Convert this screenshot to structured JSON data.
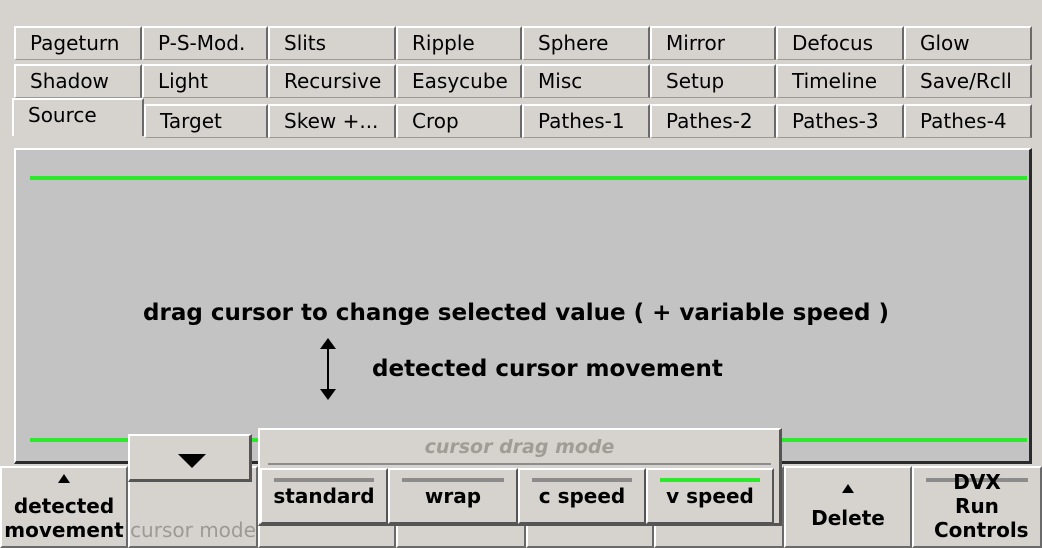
{
  "tabs": {
    "row1": [
      "Pageturn",
      "P-S-Mod.",
      "Slits",
      "Ripple",
      "Sphere",
      "Mirror",
      "Defocus",
      "Glow"
    ],
    "row2": [
      "Shadow",
      "Light",
      "Recursive",
      "Easycube",
      "Misc",
      "Setup",
      "Timeline",
      "Save/Rcll"
    ],
    "row3": [
      "Source",
      "Target",
      "Skew +...",
      "Crop",
      "Pathes-1",
      "Pathes-2",
      "Pathes-3",
      "Pathes-4"
    ],
    "selected": "Source"
  },
  "panel": {
    "instruction": "drag cursor to change selected value ( + variable speed )",
    "detected_label": "detected cursor movement",
    "line_color": "#2ee82e"
  },
  "bottom": {
    "detected_movement": "detected movement",
    "cursor_mode": "cursor mode",
    "delete": "Delete",
    "dvx_run_controls": "DVX Run Controls"
  },
  "popup": {
    "title": "cursor drag mode",
    "options": [
      "standard",
      "wrap",
      "c speed",
      "v speed"
    ],
    "selected": "v speed"
  },
  "icons": {
    "dropdown": "chevron-down-icon",
    "vertical_arrows": "up-down-arrow-icon"
  }
}
